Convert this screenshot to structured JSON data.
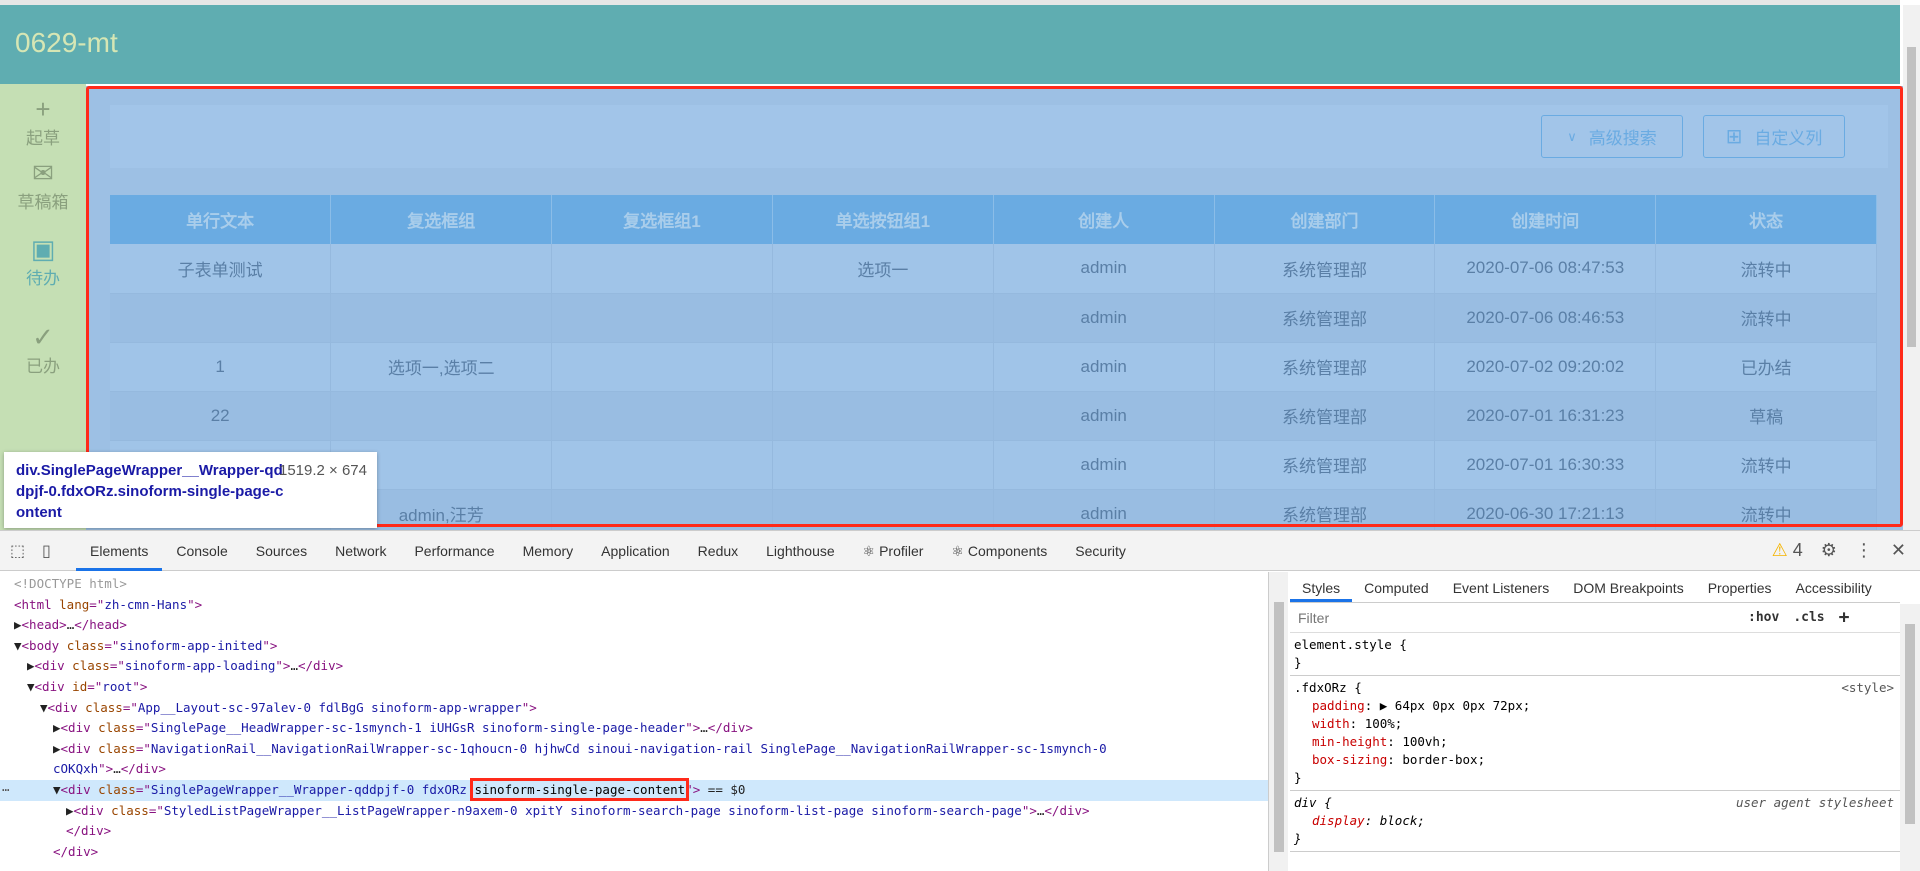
{
  "app": {
    "title": "0629-mt"
  },
  "rail": [
    {
      "icon": "plus-icon",
      "glyph": "+",
      "label": "起草"
    },
    {
      "icon": "envelope-icon",
      "glyph": "✉",
      "label": "草稿箱"
    },
    {
      "icon": "inbox-icon",
      "glyph": "▣",
      "label": "待办"
    },
    {
      "icon": "check-circle-icon",
      "glyph": "✓",
      "label": "已办"
    }
  ],
  "toolbar": {
    "advanced_search": "高级搜索",
    "custom_columns": "自定义列"
  },
  "table": {
    "columns": [
      "单行文本",
      "复选框组",
      "复选框组1",
      "单选按钮组1",
      "创建人",
      "创建部门",
      "创建时间",
      "状态"
    ],
    "rows": [
      [
        "子表单测试",
        "",
        "",
        "选项一",
        "admin",
        "系统管理部",
        "2020-07-06 08:47:53",
        "流转中"
      ],
      [
        "",
        "",
        "",
        "",
        "admin",
        "系统管理部",
        "2020-07-06 08:46:53",
        "流转中"
      ],
      [
        "1",
        "选项一,选项二",
        "",
        "",
        "admin",
        "系统管理部",
        "2020-07-02 09:20:02",
        "已办结"
      ],
      [
        "22",
        "",
        "",
        "",
        "admin",
        "系统管理部",
        "2020-07-01 16:31:23",
        "草稿"
      ],
      [
        "",
        "",
        "",
        "",
        "admin",
        "系统管理部",
        "2020-07-01 16:30:33",
        "流转中"
      ],
      [
        "",
        "admin,汪芳",
        "",
        "",
        "admin",
        "系统管理部",
        "2020-06-30 17:21:13",
        "流转中"
      ]
    ]
  },
  "tooltip": {
    "selector": "div.SinglePageWrapper__Wrapper-qddpjf-0.fdxORz.sinoform-single-page-content",
    "size": "1519.2 × 674"
  },
  "devtools": {
    "tabs": [
      "Elements",
      "Console",
      "Sources",
      "Network",
      "Performance",
      "Memory",
      "Application",
      "Redux",
      "Lighthouse",
      "⚛ Profiler",
      "⚛ Components",
      "Security"
    ],
    "warnings": "4",
    "dom": [
      {
        "i": 0,
        "s": [
          [
            "cm",
            "<!DOCTYPE html>"
          ]
        ]
      },
      {
        "i": 0,
        "s": [
          [
            "t",
            "<html "
          ],
          [
            "an",
            "lang"
          ],
          [
            "t",
            "=\""
          ],
          [
            "av",
            "zh-cmn-Hans"
          ],
          [
            "t",
            "\">"
          ]
        ]
      },
      {
        "i": 0,
        "s": [
          [
            "pl",
            "▶"
          ],
          [
            "t",
            "<head>"
          ],
          [
            "pl",
            "…"
          ],
          [
            "t",
            "</head>"
          ]
        ]
      },
      {
        "i": 0,
        "s": [
          [
            "pl",
            "▼"
          ],
          [
            "t",
            "<body "
          ],
          [
            "an",
            "class"
          ],
          [
            "t",
            "=\""
          ],
          [
            "av",
            "sinoform-app-inited"
          ],
          [
            "t",
            "\">"
          ]
        ]
      },
      {
        "i": 1,
        "s": [
          [
            "pl",
            "▶"
          ],
          [
            "t",
            "<div "
          ],
          [
            "an",
            "class"
          ],
          [
            "t",
            "=\""
          ],
          [
            "av",
            "sinoform-app-loading"
          ],
          [
            "t",
            "\">"
          ],
          [
            "pl",
            "…"
          ],
          [
            "t",
            "</div>"
          ]
        ]
      },
      {
        "i": 1,
        "s": [
          [
            "pl",
            "▼"
          ],
          [
            "t",
            "<div "
          ],
          [
            "an",
            "id"
          ],
          [
            "t",
            "=\""
          ],
          [
            "av",
            "root"
          ],
          [
            "t",
            "\">"
          ]
        ]
      },
      {
        "i": 2,
        "s": [
          [
            "pl",
            "▼"
          ],
          [
            "t",
            "<div "
          ],
          [
            "an",
            "class"
          ],
          [
            "t",
            "=\""
          ],
          [
            "av",
            "App__Layout-sc-97alev-0 fdlBgG sinoform-app-wrapper"
          ],
          [
            "t",
            "\">"
          ]
        ]
      },
      {
        "i": 3,
        "s": [
          [
            "pl",
            "▶"
          ],
          [
            "t",
            "<div "
          ],
          [
            "an",
            "class"
          ],
          [
            "t",
            "=\""
          ],
          [
            "av",
            "SinglePage__HeadWrapper-sc-1smynch-1 iUHGsR sinoform-single-page-header"
          ],
          [
            "t",
            "\">"
          ],
          [
            "pl",
            "…"
          ],
          [
            "t",
            "</div>"
          ]
        ]
      },
      {
        "i": 3,
        "s": [
          [
            "pl",
            "▶"
          ],
          [
            "t",
            "<div "
          ],
          [
            "an",
            "class"
          ],
          [
            "t",
            "=\""
          ],
          [
            "av",
            "NavigationRail__NavigationRailWrapper-sc-1qhoucn-0 hjhwCd sinoui-navigation-rail SinglePage__NavigationRailWrapper-sc-1smynch-0"
          ]
        ]
      },
      {
        "i": 3,
        "s": [
          [
            "av",
            "cOKQxh"
          ],
          [
            "t",
            "\">"
          ],
          [
            "pl",
            "…"
          ],
          [
            "t",
            "</div>"
          ]
        ]
      },
      {
        "i": 3,
        "sel": true,
        "s": [
          [
            "pl",
            "▼"
          ],
          [
            "t",
            "<div "
          ],
          [
            "an",
            "class"
          ],
          [
            "t",
            "=\""
          ],
          [
            "av",
            "SinglePageWrapper__Wrapper-qddpjf-0 fdxORz "
          ],
          [
            "hl",
            "sinoform-single-page-content"
          ],
          [
            "t",
            "\">"
          ],
          [
            "pl",
            " == $0"
          ]
        ]
      },
      {
        "i": 4,
        "s": [
          [
            "pl",
            "▶"
          ],
          [
            "t",
            "<div "
          ],
          [
            "an",
            "class"
          ],
          [
            "t",
            "=\""
          ],
          [
            "av",
            "StyledListPageWrapper__ListPageWrapper-n9axem-0 xpitY sinoform-search-page sinoform-list-page sinoform-search-page"
          ],
          [
            "t",
            "\">"
          ],
          [
            "pl",
            "…"
          ],
          [
            "t",
            "</div>"
          ]
        ]
      },
      {
        "i": 4,
        "s": [
          [
            "t",
            "</div>"
          ]
        ]
      },
      {
        "i": 3,
        "s": [
          [
            "t",
            "</div>"
          ]
        ]
      }
    ],
    "styles": {
      "tabs": [
        "Styles",
        "Computed",
        "Event Listeners",
        "DOM Breakpoints",
        "Properties",
        "Accessibility"
      ],
      "filter_placeholder": "Filter",
      "hov": ":hov",
      "cls": ".cls",
      "add": "+",
      "rules": [
        {
          "selector": "element.style {",
          "source": "",
          "props": []
        },
        {
          "selector": ".fdxORz {",
          "source": "<style>",
          "props": [
            [
              "padding",
              "▶ 64px 0px 0px 72px;"
            ],
            [
              "width",
              "100%;"
            ],
            [
              "min-height",
              "100vh;"
            ],
            [
              "box-sizing",
              "border-box;"
            ]
          ]
        },
        {
          "selector": "div {",
          "source": "user agent stylesheet",
          "props": [
            [
              "display",
              "block;"
            ]
          ]
        }
      ]
    }
  },
  "colors": {
    "header": "#5fadb1",
    "rail": "#c5dfb4",
    "highlight": "#9dc0e4",
    "table_header": "#6aabe2",
    "inspector_outline": "#ff2a1a"
  }
}
